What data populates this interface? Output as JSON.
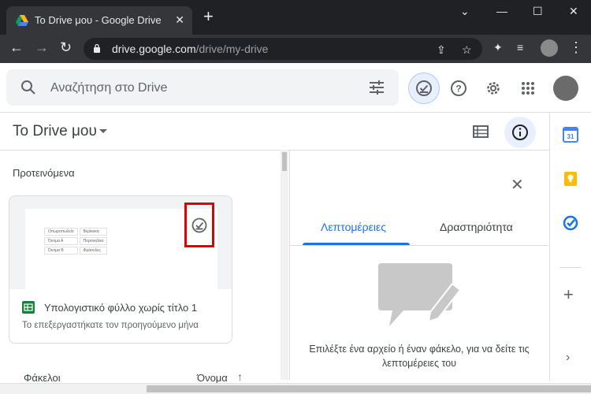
{
  "browser": {
    "tab_title": "Το Drive μου - Google Drive",
    "url_host": "drive.google.com",
    "url_path": "/drive/my-drive"
  },
  "search": {
    "placeholder": "Αναζήτηση στο Drive"
  },
  "main": {
    "title": "Το Drive μου",
    "suggested_label": "Προτεινόμενα",
    "file_card": {
      "name": "Υπολογιστικό φύλλο χωρίς τίτλο 1",
      "subtitle": "Το επεξεργαστήκατε τον προηγούμενο μήνα",
      "thumbnail_table": [
        [
          "Οπωροπωλείο",
          "Βερίκοκα"
        ],
        [
          "Όνομα Α",
          "Πορτοκάλια"
        ],
        [
          "Όνομα Β",
          "Φράουλες"
        ]
      ]
    },
    "folders_label": "Φάκελοι",
    "sort_label": "Όνομα"
  },
  "details_panel": {
    "tabs": [
      {
        "label": "Λεπτομέρειες",
        "active": true
      },
      {
        "label": "Δραστηριότητα",
        "active": false
      }
    ],
    "empty_text": "Επιλέξτε ένα αρχείο ή έναν φάκελο, για να δείτε τις λεπτομέρειες του"
  },
  "side_panel": {
    "calendar_day": "31"
  },
  "colors": {
    "accent": "#1a73e8",
    "highlight": "#e00000",
    "sheets_green": "#188038"
  }
}
